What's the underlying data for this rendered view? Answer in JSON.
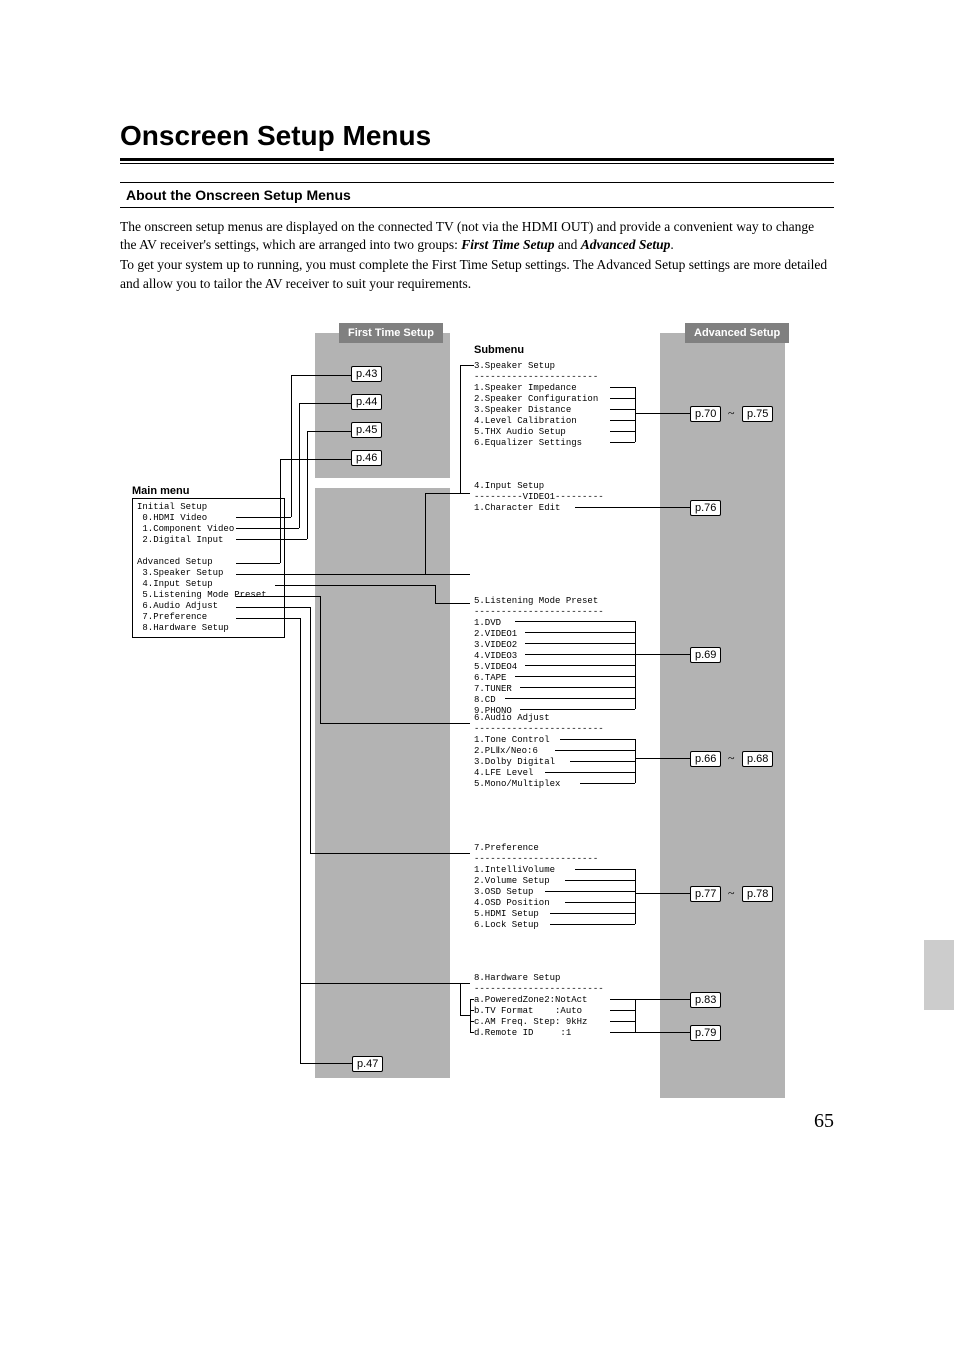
{
  "page": {
    "title": "Onscreen Setup Menus",
    "section_heading": "About the Onscreen Setup Menus",
    "para1_a": "The onscreen setup menus are displayed on the connected TV (not via the HDMI OUT) and provide a convenient way to change the AV receiver's settings, which are arranged into two groups: ",
    "para1_b": "First Time Setup",
    "para1_c": " and ",
    "para1_d": "Advanced Setup",
    "para1_e": ".",
    "para2": "To get your system up to running, you must complete the First Time Setup settings. The Advanced Setup settings are more detailed and allow you to tailor the AV receiver to suit your requirements.",
    "page_number": "65"
  },
  "labels": {
    "main_menu": "Main menu",
    "submenu": "Submenu",
    "first_time": "First Time Setup",
    "advanced": "Advanced Setup"
  },
  "main_menu_box": "Initial Setup\n 0.HDMI Video\n 1.Component Video\n 2.Digital Input\n\nAdvanced Setup\n 3.Speaker Setup\n 4.Input Setup\n 5.Listening Mode Preset\n 6.Audio Adjust\n 7.Preference\n 8.Hardware Setup",
  "sub": {
    "speaker": "3.Speaker Setup\n-----------------------\n1.Speaker Impedance\n2.Speaker Configuration\n3.Speaker Distance\n4.Level Calibration\n5.THX Audio Setup\n6.Equalizer Settings",
    "input": "4.Input Setup\n---------VIDEO1---------\n1.Character Edit",
    "listening": "5.Listening Mode Preset\n------------------------\n1.DVD\n2.VIDEO1\n3.VIDEO2\n4.VIDEO3\n5.VIDEO4\n6.TAPE\n7.TUNER\n8.CD\n9.PHONO",
    "audio": "6.Audio Adjust\n------------------------\n1.Tone Control\n2.PLⅡx/Neo:6\n3.Dolby Digital\n4.LFE Level\n5.Mono/Multiplex",
    "pref": "7.Preference\n-----------------------\n1.IntelliVolume\n2.Volume Setup\n3.OSD Setup\n4.OSD Position\n5.HDMI Setup\n6.Lock Setup",
    "hardware": "8.Hardware Setup\n------------------------\na.PoweredZone2:NotAct\nb.TV Format    :Auto\nc.AM Freq. Step: 9kHz\nd.Remote ID     :1"
  },
  "prefs": {
    "p43": "p.43",
    "p44": "p.44",
    "p45": "p.45",
    "p46": "p.46",
    "p47": "p.47",
    "p70": "p.70",
    "p75": "p.75",
    "p76": "p.76",
    "p69": "p.69",
    "p66": "p.66",
    "p68": "p.68",
    "p77": "p.77",
    "p78": "p.78",
    "p83": "p.83",
    "p79": "p.79"
  },
  "tilde": "~"
}
